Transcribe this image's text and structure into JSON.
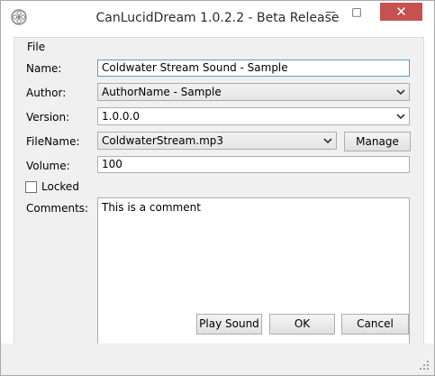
{
  "window": {
    "title": "CanLucidDream 1.0.2.2 - Beta Release",
    "minimize": "—",
    "maximize": "□",
    "close": "✕"
  },
  "menu": {
    "file": "File"
  },
  "form": {
    "name_label": "Name:",
    "name_value": "Coldwater Stream Sound - Sample",
    "author_label": "Author:",
    "author_value": "AuthorName - Sample",
    "version_label": "Version:",
    "version_value": "1.0.0.0",
    "filename_label": "FileName:",
    "filename_value": "ColdwaterStream.mp3",
    "manage_label": "Manage",
    "volume_label": "Volume:",
    "volume_value": "100",
    "locked_label": "Locked",
    "locked_checked": false,
    "comments_label": "Comments:",
    "comments_value": "This is a comment"
  },
  "buttons": {
    "play_sound": "Play Sound",
    "ok": "OK",
    "cancel": "Cancel"
  },
  "icons": {
    "app": "film-reel-icon",
    "dropdown": "chevron-down-icon",
    "resize": "resize-grip-icon"
  },
  "colors": {
    "close_button": "#c75050",
    "focus_border": "#5b9bd5",
    "panel_background": "#f0f0f0"
  }
}
